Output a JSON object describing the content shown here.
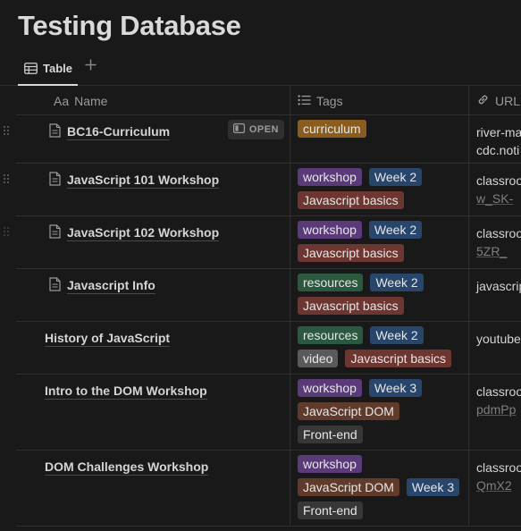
{
  "page": {
    "title": "Testing Database"
  },
  "view": {
    "active_tab": "Table",
    "add_view_icon": "plus-icon"
  },
  "table": {
    "columns": {
      "name": {
        "prefix": "Aa",
        "label": "Name"
      },
      "tags": {
        "label": "Tags",
        "icon": "list-icon"
      },
      "url": {
        "label": "URL",
        "icon": "link-icon"
      }
    },
    "open_label": "OPEN",
    "rows": [
      {
        "name": "BC16-Curriculum",
        "has_page_icon": true,
        "tags": [
          {
            "label": "curriculum",
            "color": "#8a5d1f"
          }
        ],
        "url_line1": "river-ma",
        "url_line2": "cdc.noti"
      },
      {
        "name": "JavaScript 101 Workshop",
        "has_page_icon": true,
        "tags": [
          {
            "label": "workshop",
            "color": "#5b3a7a"
          },
          {
            "label": "Week 2",
            "color": "#28456c"
          },
          {
            "label": "Javascript basics",
            "color": "#6e3630"
          }
        ],
        "url_line1": "classroo",
        "url_line2": "w_SK-"
      },
      {
        "name": "JavaScript 102 Workshop",
        "has_page_icon": true,
        "tags": [
          {
            "label": "workshop",
            "color": "#5b3a7a"
          },
          {
            "label": "Week 2",
            "color": "#28456c"
          },
          {
            "label": "Javascript basics",
            "color": "#6e3630"
          }
        ],
        "url_line1": "classroo",
        "url_line2": "5ZR_"
      },
      {
        "name": "Javascript Info",
        "has_page_icon": true,
        "tags": [
          {
            "label": "resources",
            "color": "#2b593f"
          },
          {
            "label": "Week 2",
            "color": "#28456c"
          },
          {
            "label": "Javascript basics",
            "color": "#6e3630"
          }
        ],
        "url_line1": "javascrip",
        "url_line2": ""
      },
      {
        "name": "History of JavaScript",
        "has_page_icon": false,
        "tags": [
          {
            "label": "resources",
            "color": "#2b593f"
          },
          {
            "label": "Week 2",
            "color": "#28456c"
          },
          {
            "label": "video",
            "color": "#5a5a5a"
          },
          {
            "label": "Javascript basics",
            "color": "#6e3630"
          }
        ],
        "url_line1": "youtube",
        "url_line2": ""
      },
      {
        "name": "Intro to the DOM Workshop",
        "has_page_icon": false,
        "tags": [
          {
            "label": "workshop",
            "color": "#5b3a7a"
          },
          {
            "label": "Week 3",
            "color": "#28456c"
          },
          {
            "label": "JavaScript DOM",
            "color": "#603b2c"
          },
          {
            "label": "Front-end",
            "color": "#373737"
          }
        ],
        "url_line1": "classroo",
        "url_line2": "pdmPp"
      },
      {
        "name": "DOM Challenges Workshop",
        "has_page_icon": false,
        "tags": [
          {
            "label": "workshop",
            "color": "#5b3a7a"
          },
          {
            "label": "JavaScript DOM",
            "color": "#603b2c"
          },
          {
            "label": "Week 3",
            "color": "#28456c"
          },
          {
            "label": "Front-end",
            "color": "#373737"
          }
        ],
        "url_line1": "classroo",
        "url_line2": "QmX2"
      }
    ]
  }
}
